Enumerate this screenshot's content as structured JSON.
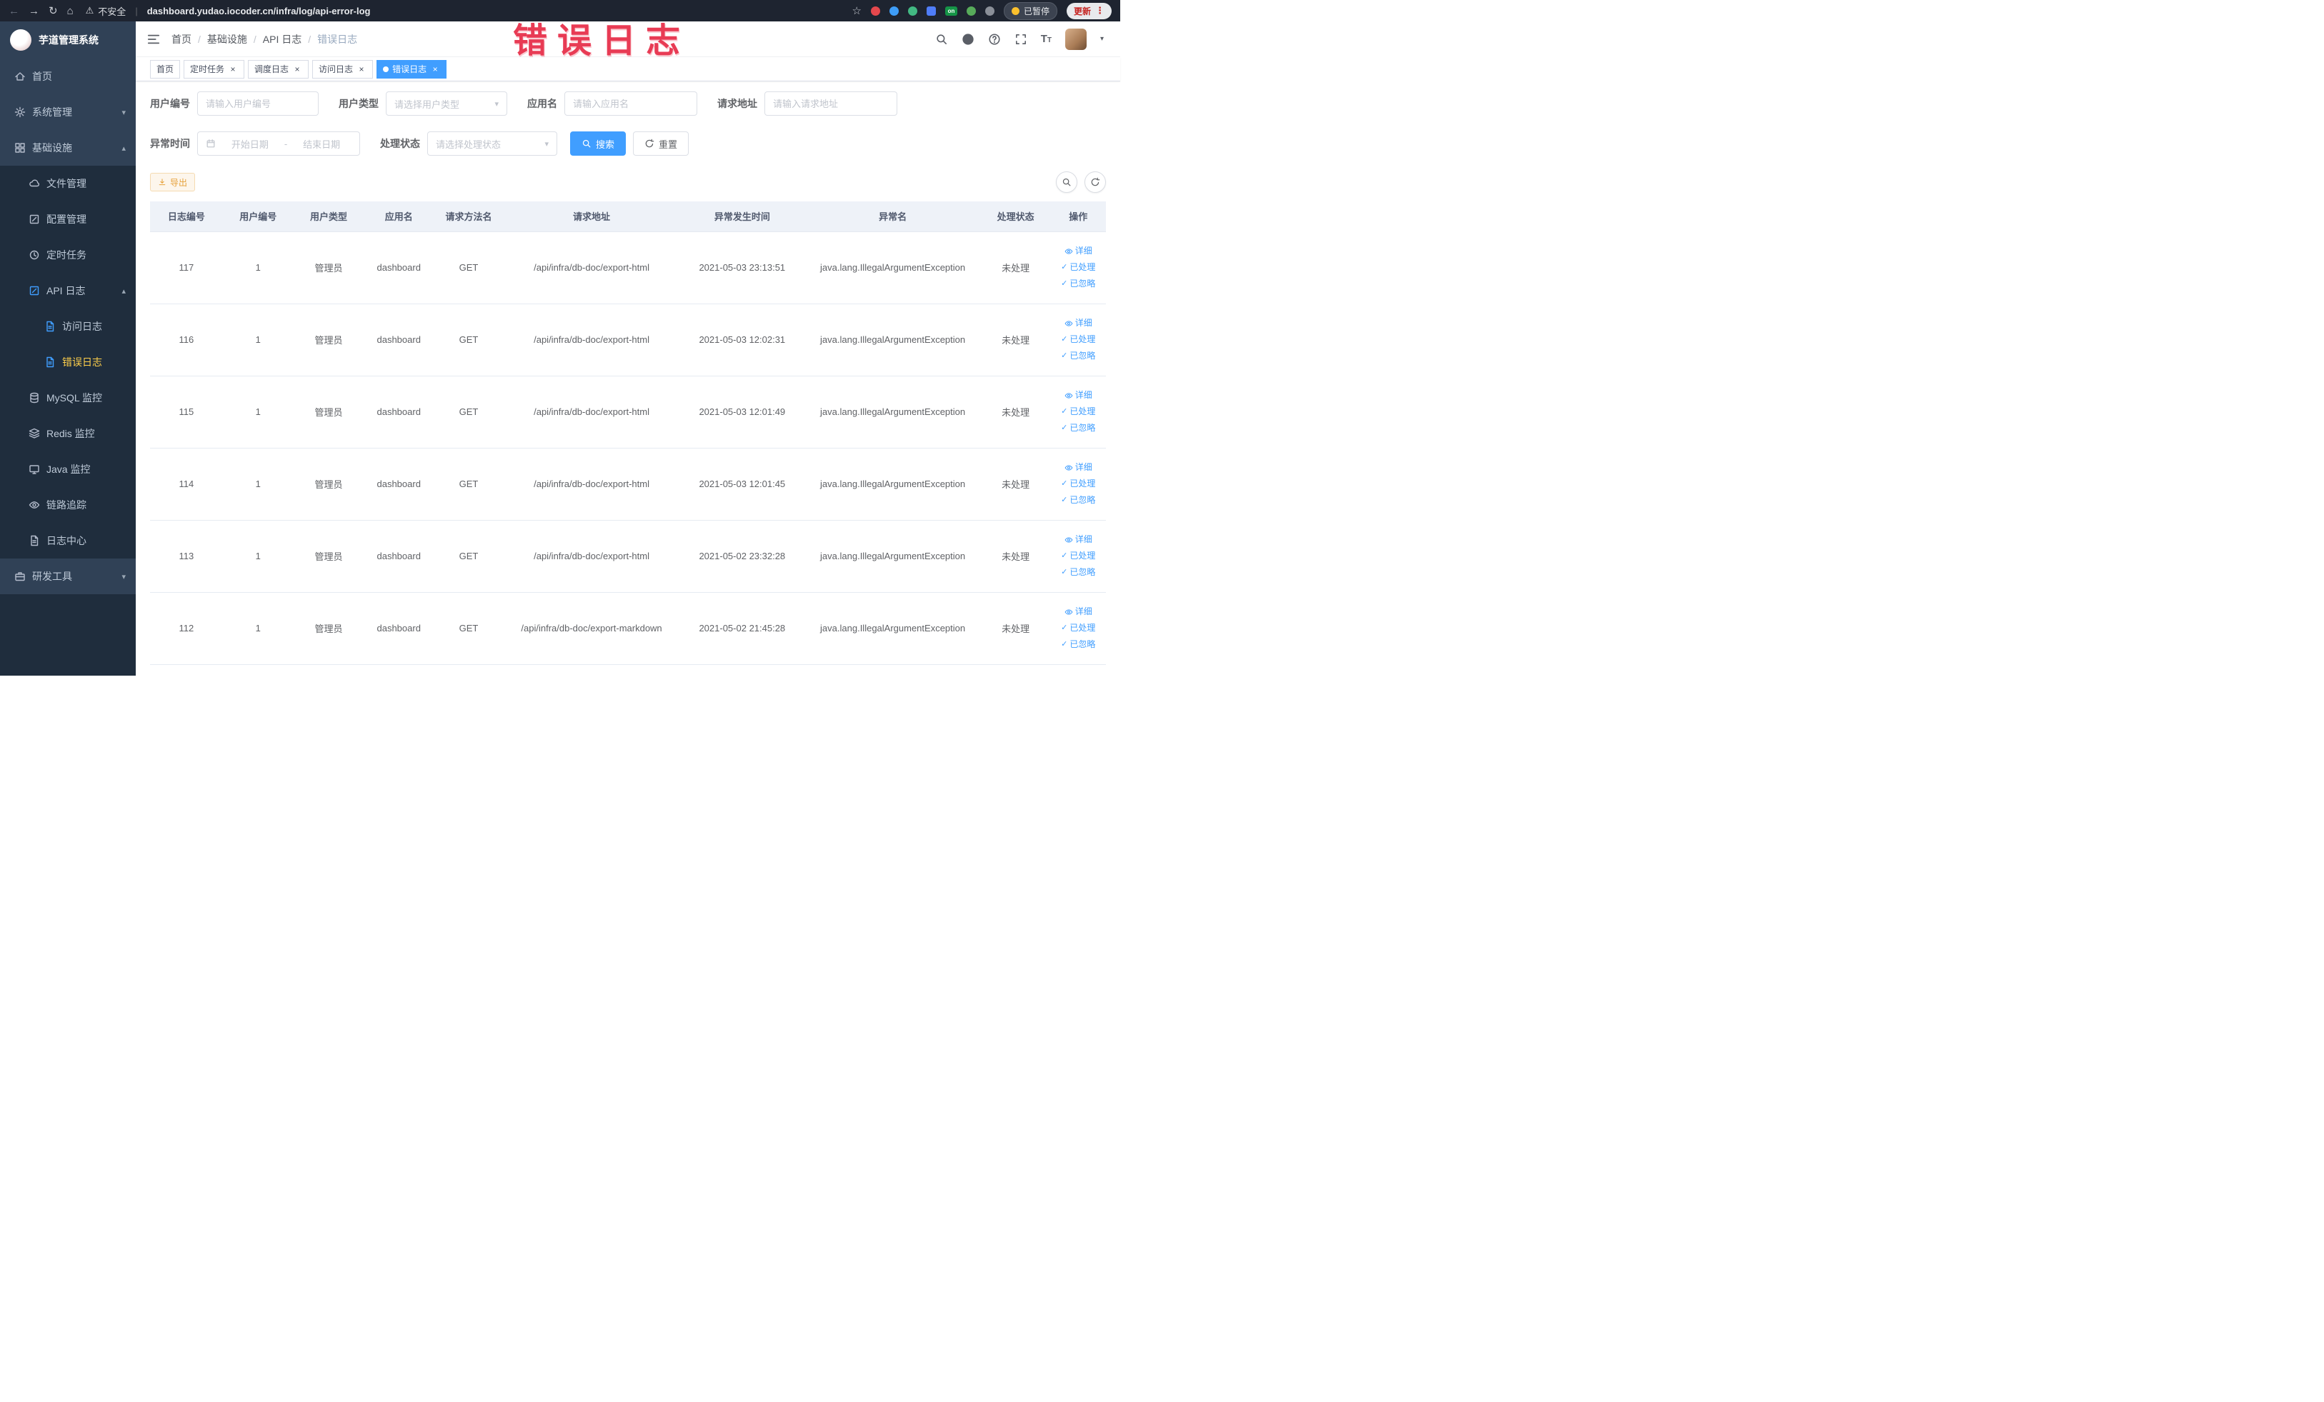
{
  "browser": {
    "security_label": "不安全",
    "url": "dashboard.yudao.iocoder.cn/infra/log/api-error-log",
    "paused_label": "已暂停",
    "update_label": "更新",
    "extension_on_label": "on"
  },
  "sidebar": {
    "app_title": "芋道管理系统",
    "items": [
      {
        "label": "首页"
      },
      {
        "label": "系统管理"
      },
      {
        "label": "基础设施"
      },
      {
        "label": "文件管理"
      },
      {
        "label": "配置管理"
      },
      {
        "label": "定时任务"
      },
      {
        "label": "API 日志"
      },
      {
        "label": "访问日志"
      },
      {
        "label": "错误日志"
      },
      {
        "label": "MySQL 监控"
      },
      {
        "label": "Redis 监控"
      },
      {
        "label": "Java 监控"
      },
      {
        "label": "链路追踪"
      },
      {
        "label": "日志中心"
      },
      {
        "label": "研发工具"
      }
    ]
  },
  "header": {
    "breadcrumb": [
      "首页",
      "基础设施",
      "API 日志",
      "错误日志"
    ]
  },
  "tabs": [
    {
      "label": "首页"
    },
    {
      "label": "定时任务"
    },
    {
      "label": "调度日志"
    },
    {
      "label": "访问日志"
    },
    {
      "label": "错误日志"
    }
  ],
  "annotation": {
    "text": "错误日志"
  },
  "filters": {
    "user_id": {
      "label": "用户编号",
      "placeholder": "请输入用户编号"
    },
    "user_type": {
      "label": "用户类型",
      "placeholder": "请选择用户类型"
    },
    "app_name": {
      "label": "应用名",
      "placeholder": "请输入应用名"
    },
    "request_url": {
      "label": "请求地址",
      "placeholder": "请输入请求地址"
    },
    "exception_time": {
      "label": "异常时间",
      "start_placeholder": "开始日期",
      "separator": "-",
      "end_placeholder": "结束日期"
    },
    "process_status": {
      "label": "处理状态",
      "placeholder": "请选择处理状态"
    },
    "search_label": "搜索",
    "reset_label": "重置"
  },
  "toolbar": {
    "export_label": "导出"
  },
  "table": {
    "columns": [
      "日志编号",
      "用户编号",
      "用户类型",
      "应用名",
      "请求方法名",
      "请求地址",
      "异常发生时间",
      "异常名",
      "处理状态",
      "操作"
    ],
    "actions": [
      "详细",
      "已处理",
      "已忽略"
    ],
    "rows": [
      {
        "id": "117",
        "user_id": "1",
        "user_type": "管理员",
        "app_name": "dashboard",
        "method": "GET",
        "url": "/api/infra/db-doc/export-html",
        "time": "2021-05-03 23:13:51",
        "exception": "java.lang.IllegalArgumentException",
        "status": "未处理"
      },
      {
        "id": "116",
        "user_id": "1",
        "user_type": "管理员",
        "app_name": "dashboard",
        "method": "GET",
        "url": "/api/infra/db-doc/export-html",
        "time": "2021-05-03 12:02:31",
        "exception": "java.lang.IllegalArgumentException",
        "status": "未处理"
      },
      {
        "id": "115",
        "user_id": "1",
        "user_type": "管理员",
        "app_name": "dashboard",
        "method": "GET",
        "url": "/api/infra/db-doc/export-html",
        "time": "2021-05-03 12:01:49",
        "exception": "java.lang.IllegalArgumentException",
        "status": "未处理"
      },
      {
        "id": "114",
        "user_id": "1",
        "user_type": "管理员",
        "app_name": "dashboard",
        "method": "GET",
        "url": "/api/infra/db-doc/export-html",
        "time": "2021-05-03 12:01:45",
        "exception": "java.lang.IllegalArgumentException",
        "status": "未处理"
      },
      {
        "id": "113",
        "user_id": "1",
        "user_type": "管理员",
        "app_name": "dashboard",
        "method": "GET",
        "url": "/api/infra/db-doc/export-html",
        "time": "2021-05-02 23:32:28",
        "exception": "java.lang.IllegalArgumentException",
        "status": "未处理"
      },
      {
        "id": "112",
        "user_id": "1",
        "user_type": "管理员",
        "app_name": "dashboard",
        "method": "GET",
        "url": "/api/infra/db-doc/export-markdown",
        "time": "2021-05-02 21:45:28",
        "exception": "java.lang.IllegalArgumentException",
        "status": "未处理"
      }
    ]
  },
  "icons": {
    "back": "←",
    "forward": "→",
    "reload": "↻",
    "home": "⌂",
    "warning": "⚠",
    "star": "☆",
    "kebab": "⋮",
    "pipe": "|",
    "separator_slash": "/",
    "chevron_down": "▾",
    "chevron_up": "▴",
    "caret_down": "▾",
    "close": "×",
    "check": "✓",
    "font_size": "T"
  },
  "colors": {
    "primary": "#409eff",
    "warning": "#e6a23c",
    "annotation_red": "#e83b54",
    "sidebar_bg": "#304156",
    "sidebar_submenu_bg": "#1f2d3d",
    "sidebar_active_text": "#ffd04b"
  }
}
